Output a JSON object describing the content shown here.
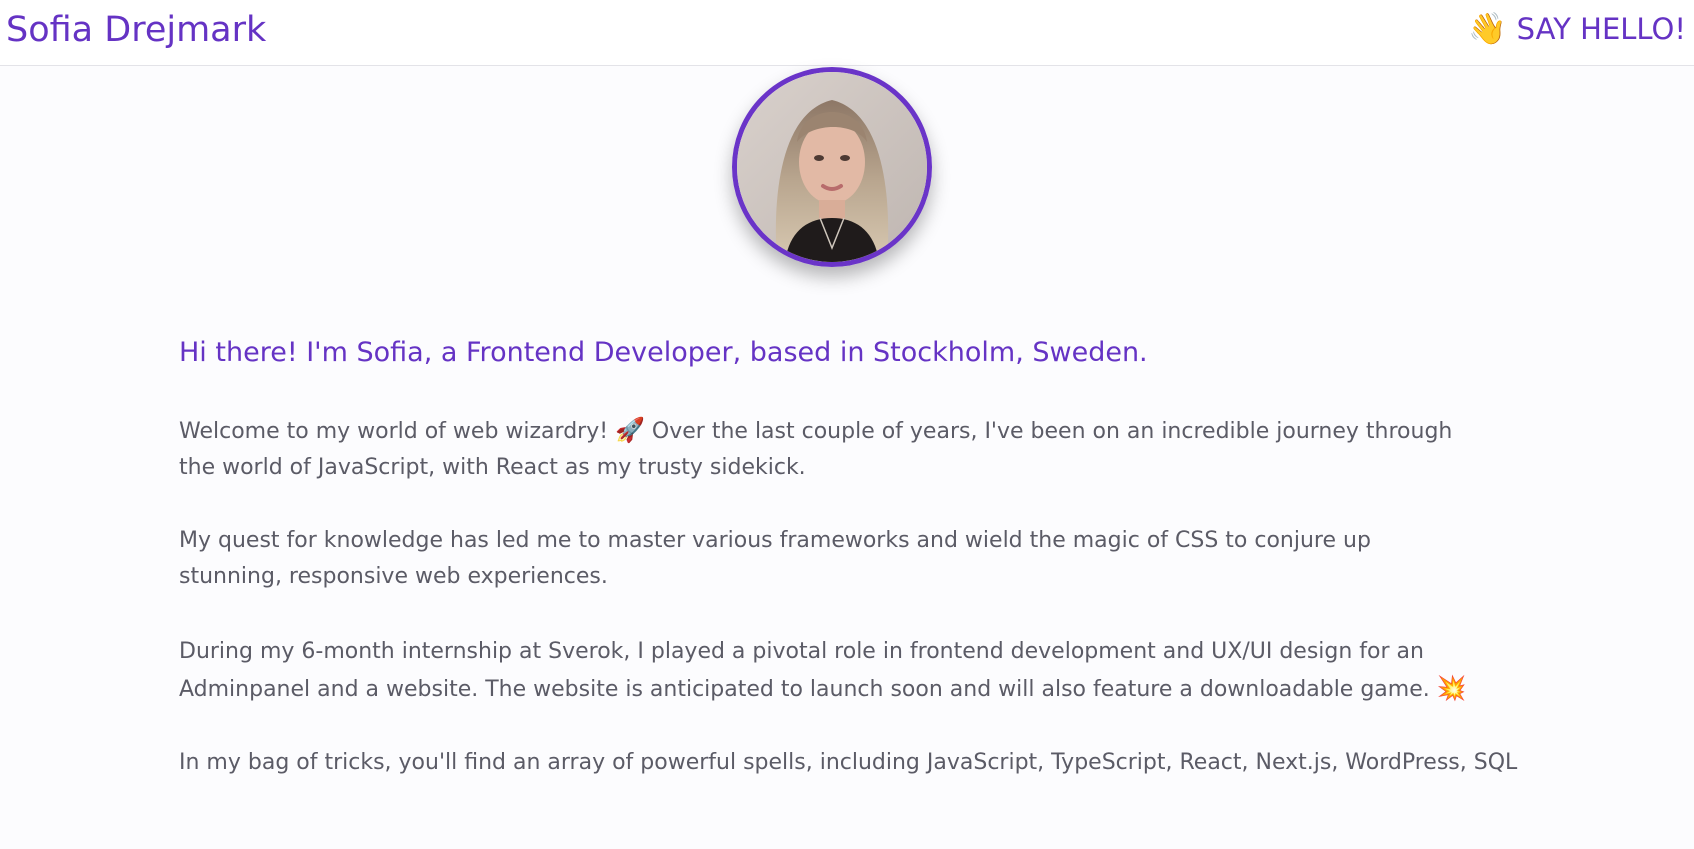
{
  "header": {
    "brand": "Sofia Drejmark",
    "cta_icon": "👋",
    "cta_label": "SAY HELLO!"
  },
  "profile": {
    "avatar": "profile-photo"
  },
  "about": {
    "heading": "Hi there! I'm Sofia, a Frontend Developer, based in Stockholm, Sweden.",
    "p1_before": "Welcome to my world of web wizardry! ",
    "p1_emoji": "🚀",
    "p1_after": " Over the last couple of years, I've been on an incredible journey through the world of JavaScript, with React as my trusty sidekick.",
    "p2": "My quest for knowledge has led me to master various frameworks and wield the magic of CSS to conjure up stunning, responsive web experiences.",
    "p3_before": "During my 6-month internship at Sverok, I played a pivotal role in frontend development and UX/UI design for an Adminpanel and a website. The website is anticipated to launch soon and will also feature a downloadable game. ",
    "p3_emoji": "💥",
    "p4": "In my bag of tricks, you'll find an array of powerful spells, including JavaScript, TypeScript, React, Next.js, WordPress, SQL"
  },
  "colors": {
    "accent": "#6533c4",
    "text": "#5b5b66",
    "background": "#fcfcfe"
  }
}
